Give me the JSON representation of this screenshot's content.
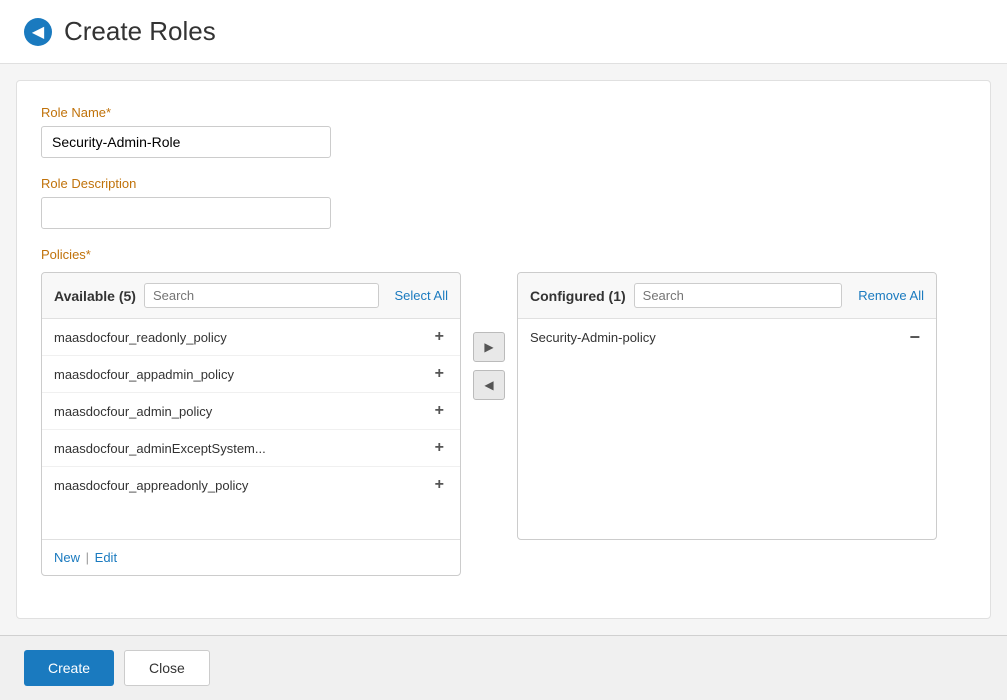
{
  "header": {
    "back_label": "◀",
    "title": "Create Roles"
  },
  "form": {
    "role_name_label": "Role Name*",
    "role_name_value": "Security-Admin-Role",
    "role_name_placeholder": "",
    "role_description_label": "Role Description",
    "role_description_value": "",
    "role_description_placeholder": "",
    "policies_label": "Policies*"
  },
  "available_panel": {
    "title": "Available (5)",
    "search_placeholder": "Search",
    "select_all_label": "Select All",
    "items": [
      {
        "name": "maasdocfour_readonly_policy"
      },
      {
        "name": "maasdocfour_appadmin_policy"
      },
      {
        "name": "maasdocfour_admin_policy"
      },
      {
        "name": "maasdocfour_adminExceptSystem..."
      },
      {
        "name": "maasdocfour_appreadonly_policy"
      }
    ],
    "footer_new_label": "New",
    "footer_separator": "|",
    "footer_edit_label": "Edit"
  },
  "configured_panel": {
    "title": "Configured (1)",
    "search_placeholder": "Search",
    "remove_all_label": "Remove All",
    "items": [
      {
        "name": "Security-Admin-policy"
      }
    ]
  },
  "transfer": {
    "forward_icon": "▶",
    "backward_icon": "◀"
  },
  "footer": {
    "create_label": "Create",
    "close_label": "Close"
  }
}
